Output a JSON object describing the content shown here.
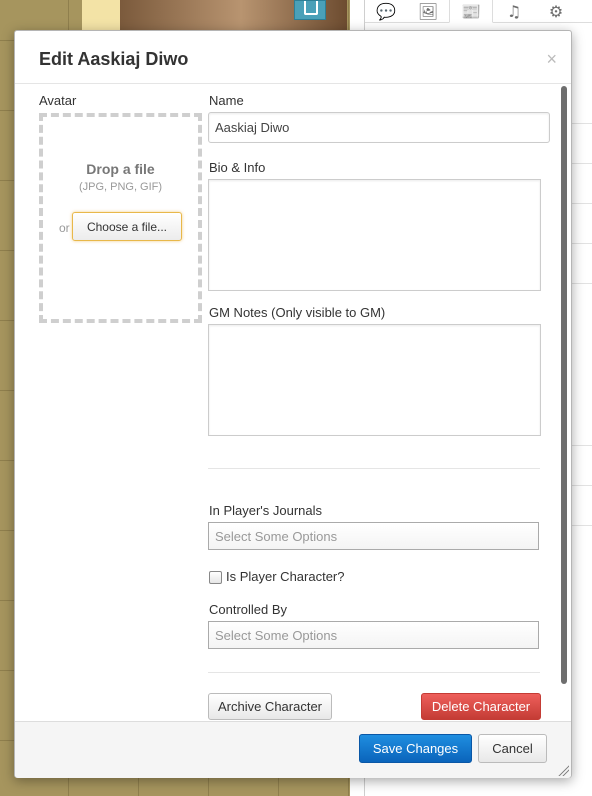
{
  "right_panel": {
    "tabs": [
      {
        "icon": "chat-icon",
        "glyph": "💬"
      },
      {
        "icon": "image-icon",
        "glyph": "🖼"
      },
      {
        "icon": "journal-icon",
        "glyph": "📰"
      },
      {
        "icon": "music-icon",
        "glyph": "♫"
      },
      {
        "icon": "gear-icon",
        "glyph": "⚙"
      }
    ]
  },
  "dialog": {
    "title": "Edit Aaskiaj Diwo",
    "close_glyph": "×",
    "avatar": {
      "label": "Avatar",
      "drop_title": "Drop a file",
      "drop_types": "(JPG, PNG, GIF)",
      "or_text": "or",
      "choose_label": "Choose a file..."
    },
    "name": {
      "label": "Name",
      "value": "Aaskiaj Diwo"
    },
    "bio": {
      "label": "Bio & Info",
      "value": ""
    },
    "gm_notes": {
      "label": "GM Notes (Only visible to GM)",
      "value": ""
    },
    "in_players_journals": {
      "label": "In Player's Journals",
      "placeholder": "Select Some Options"
    },
    "is_player_character": {
      "label": "Is Player Character?",
      "checked": false
    },
    "controlled_by": {
      "label": "Controlled By",
      "placeholder": "Select Some Options"
    },
    "archive_label": "Archive Character",
    "delete_label": "Delete Character",
    "save_label": "Save Changes",
    "cancel_label": "Cancel"
  },
  "colors": {
    "primary": "#0a64bb",
    "danger": "#c43c35",
    "focus_outline": "#e8b84a",
    "map_background": "#a6955e"
  }
}
